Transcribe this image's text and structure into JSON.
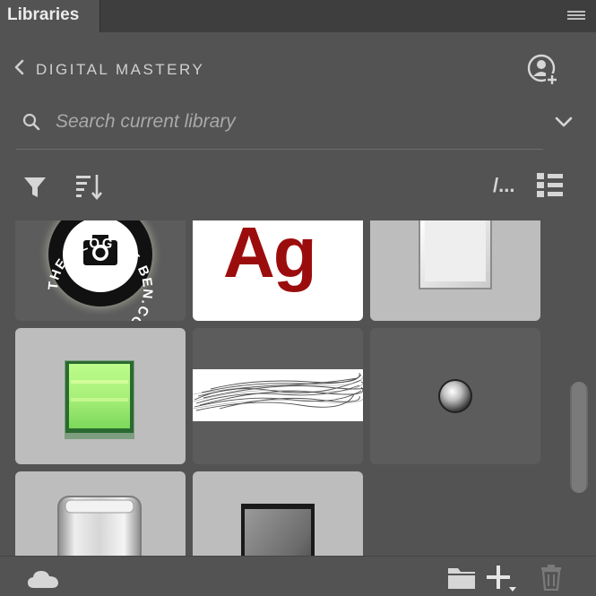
{
  "panel": {
    "tab_label": "Libraries",
    "menu_icon": "hamburger-menu-icon"
  },
  "header": {
    "back_icon": "chevron-left-icon",
    "library_name": "DIGITAL MASTERY",
    "user_icon": "add-user-icon"
  },
  "search": {
    "placeholder": "Search current library",
    "value": "",
    "search_icon": "magnifier-icon",
    "dropdown_icon": "chevron-down-icon"
  },
  "toolbar": {
    "filter_icon": "funnel-icon",
    "sort_icon": "sort-icon",
    "path_label": "/...",
    "view_icon": "list-view-icon"
  },
  "assets": {
    "seal_text": "THE BLOG OF BEN.COM",
    "char_style_sample": "Ag",
    "char_style_color": "#9b0d0d",
    "items": [
      {
        "name": "blog-of-ben-logo"
      },
      {
        "name": "character-style-ag"
      },
      {
        "name": "white-square-button"
      },
      {
        "name": "green-glass-square"
      },
      {
        "name": "pencil-brush-stroke"
      },
      {
        "name": "chrome-ball"
      },
      {
        "name": "glass-cylinder"
      },
      {
        "name": "dark-metal-square"
      }
    ]
  },
  "footer": {
    "cloud_icon": "cloud-icon",
    "folder_icon": "folder-icon",
    "add_icon": "plus-icon",
    "trash_icon": "trash-icon"
  },
  "colors": {
    "panel_bg": "#535353",
    "tabbar_bg": "#3e3e3e",
    "tile_light": "#bdbdbd",
    "tile_dark": "#5c5c5c"
  }
}
